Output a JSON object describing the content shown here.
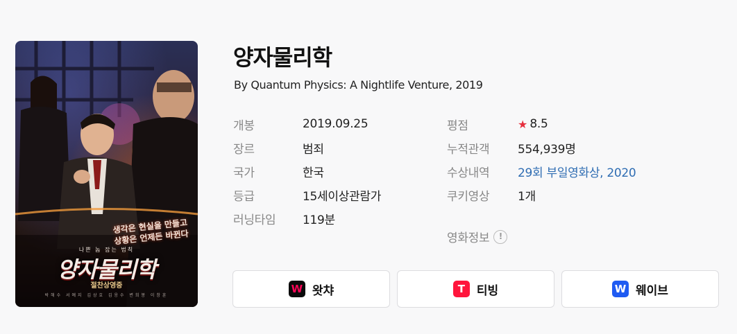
{
  "movie": {
    "title": "양자물리학",
    "subtitle": "By Quantum Physics: A Nightlife Venture, 2019"
  },
  "poster": {
    "tagline_line1": "생각은 현실을 만들고",
    "tagline_line2": "상황은 언제든 바뀐다",
    "small_tag": "나쁜 놈 잡는 법칙",
    "title": "양자물리학",
    "subtitle": "절찬상영중",
    "credits": "박해수   서예지   김상호   김응수   변희봉   이창훈"
  },
  "info": {
    "left": [
      {
        "label": "개봉",
        "value": "2019.09.25"
      },
      {
        "label": "장르",
        "value": "범죄"
      },
      {
        "label": "국가",
        "value": "한국"
      },
      {
        "label": "등급",
        "value": "15세이상관람가"
      },
      {
        "label": "러닝타임",
        "value": "119분"
      }
    ],
    "right": [
      {
        "label": "평점",
        "value": "8.5",
        "icon": "star-icon"
      },
      {
        "label": "누적관객",
        "value": "554,939명"
      },
      {
        "label": "수상내역",
        "value": "29회 부일영화상, 2020"
      },
      {
        "label": "쿠키영상",
        "value": "1개"
      }
    ],
    "movie_info_label": "영화정보",
    "movie_info_icon": "!"
  },
  "ott": [
    {
      "name": "왓챠",
      "logo_letter": "W",
      "logo_color": "#ff0558",
      "logo_bg": "#0b0b0b"
    },
    {
      "name": "티빙",
      "logo_letter": "T",
      "logo_color": "#ffffff",
      "logo_bg": "#ff153c"
    },
    {
      "name": "웨이브",
      "logo_letter": "W",
      "logo_color": "#ffffff",
      "logo_bg": "#1f5bf2"
    }
  ],
  "colors": {
    "star": "#e62e3d",
    "link": "#2f6db3",
    "background": "#f8f8f9"
  }
}
